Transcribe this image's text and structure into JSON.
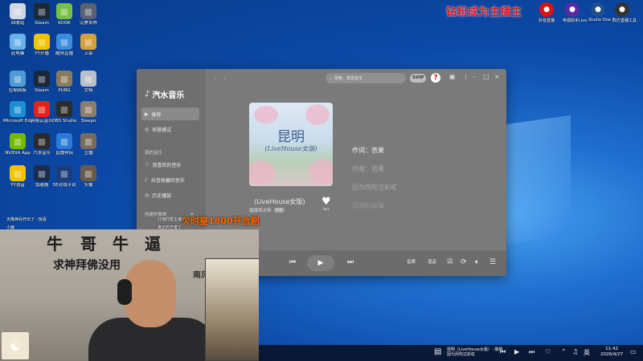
{
  "desktop": {
    "icons": [
      {
        "name": "recycle-bin",
        "label": "回收站",
        "color": "#cfd8e3"
      },
      {
        "name": "steam",
        "label": "Steam",
        "color": "#1b2838"
      },
      {
        "name": "kook",
        "label": "KOOK",
        "color": "#77c043"
      },
      {
        "name": "game-icon",
        "label": "完美世界",
        "color": "#5a6270"
      },
      {
        "name": "computer",
        "label": "此电脑",
        "color": "#6ab0e8"
      },
      {
        "name": "yy",
        "label": "YY开播",
        "color": "#f2c300"
      },
      {
        "name": "kugou",
        "label": "酷狗直播",
        "color": "#3a8ddd"
      },
      {
        "name": "cook",
        "label": "上菜",
        "color": "#d6a03a"
      },
      {
        "name": "control-panel",
        "label": "控制面板",
        "color": "#4e9bd6"
      },
      {
        "name": "steam-2",
        "label": "Steam",
        "color": "#1b2838"
      },
      {
        "name": "pubg",
        "label": "PUBG",
        "color": "#8a7a5a"
      },
      {
        "name": "file",
        "label": "文档",
        "color": "#b9c0c8"
      },
      {
        "name": "edge",
        "label": "Microsoft Edge",
        "color": "#1a8fd4"
      },
      {
        "name": "netease",
        "label": "网易云音乐",
        "color": "#e2231a"
      },
      {
        "name": "obs",
        "label": "OBS Studio",
        "color": "#2c2c2c"
      },
      {
        "name": "person",
        "label": "Sleepo",
        "color": "#8c7c6c"
      },
      {
        "name": "nvidia",
        "label": "NVIDIA App",
        "color": "#76b900"
      },
      {
        "name": "qishui",
        "label": "汽水音乐",
        "color": "#2a2a2a"
      },
      {
        "name": "stream-tool",
        "label": "直播伴侣",
        "color": "#2a7bd8"
      },
      {
        "name": "person2",
        "label": "主播",
        "color": "#7a6a5a"
      },
      {
        "name": "yy-2",
        "label": "YY语音",
        "color": "#f2c300"
      },
      {
        "name": "game2",
        "label": "加速器",
        "color": "#1b2b4b"
      },
      {
        "name": "5e",
        "label": "5E对战平台",
        "color": "#1d3d7a"
      },
      {
        "name": "person3",
        "label": "头像",
        "color": "#6a5a4a"
      }
    ]
  },
  "topright": {
    "banner": "钻粉成为主播主",
    "icons": [
      {
        "name": "douyin",
        "label": "抖音直播",
        "color": "#d11"
      },
      {
        "name": "music-live",
        "label": "电视助手Live",
        "color": "#5a2ca0"
      },
      {
        "name": "studio-one",
        "label": "Studio One 7",
        "color": "#1f4f8f"
      },
      {
        "name": "tool",
        "label": "四方直播工具",
        "color": "#333"
      }
    ]
  },
  "app": {
    "name": "汽水音乐",
    "nav": {
      "recommend": "推荐",
      "listen_mode": "听歌模式",
      "section_mine": "我的音乐",
      "liked": "我喜欢的音乐",
      "douyin_fav": "抖音收藏的音乐",
      "history": "历史播放",
      "section_playlists": "创建的歌单"
    },
    "search_placeholder": "搜索，发现音乐",
    "svip": "SVIP",
    "cover": {
      "title": "昆明",
      "subtitle": "(LiveHouse女版)"
    },
    "song": {
      "title": "(LiveHouse女版)",
      "artist": "璐璐很冰爽",
      "badge": "原曲",
      "likes": "1w+"
    },
    "lyrics": [
      {
        "text": "作词：苦果",
        "state": "current"
      },
      {
        "text": "作曲：苦果",
        "state": "dim"
      },
      {
        "text": "因为风吹过彩虹",
        "state": "dim"
      },
      {
        "text": "昆明的故事",
        "state": "faint"
      }
    ],
    "player": {
      "quality": "音质",
      "effect": "混音",
      "lyric": "词"
    }
  },
  "stream": {
    "messages": [
      {
        "text": "天降神兵开出了 · 惊喜",
        "x": "top"
      },
      {
        "text": "小鹿",
        "x": "bottom"
      },
      {
        "text": "打榜同框主播1",
        "x": "mid"
      },
      {
        "text": "真正的王者了",
        "x": "mid2"
      }
    ],
    "scroll": "欠时皇1800开合剧",
    "calligraphy": [
      "牛",
      "哥",
      "牛",
      "逼",
      "求神拜佛没用",
      "南风不吹"
    ]
  },
  "taskbar": {
    "media_title": "昆明（LiveHouse女版）- 璐璐...",
    "media_sub": "因为风吹过彩虹",
    "ime": "英",
    "time": "11:42",
    "date": "2026/4/27"
  }
}
